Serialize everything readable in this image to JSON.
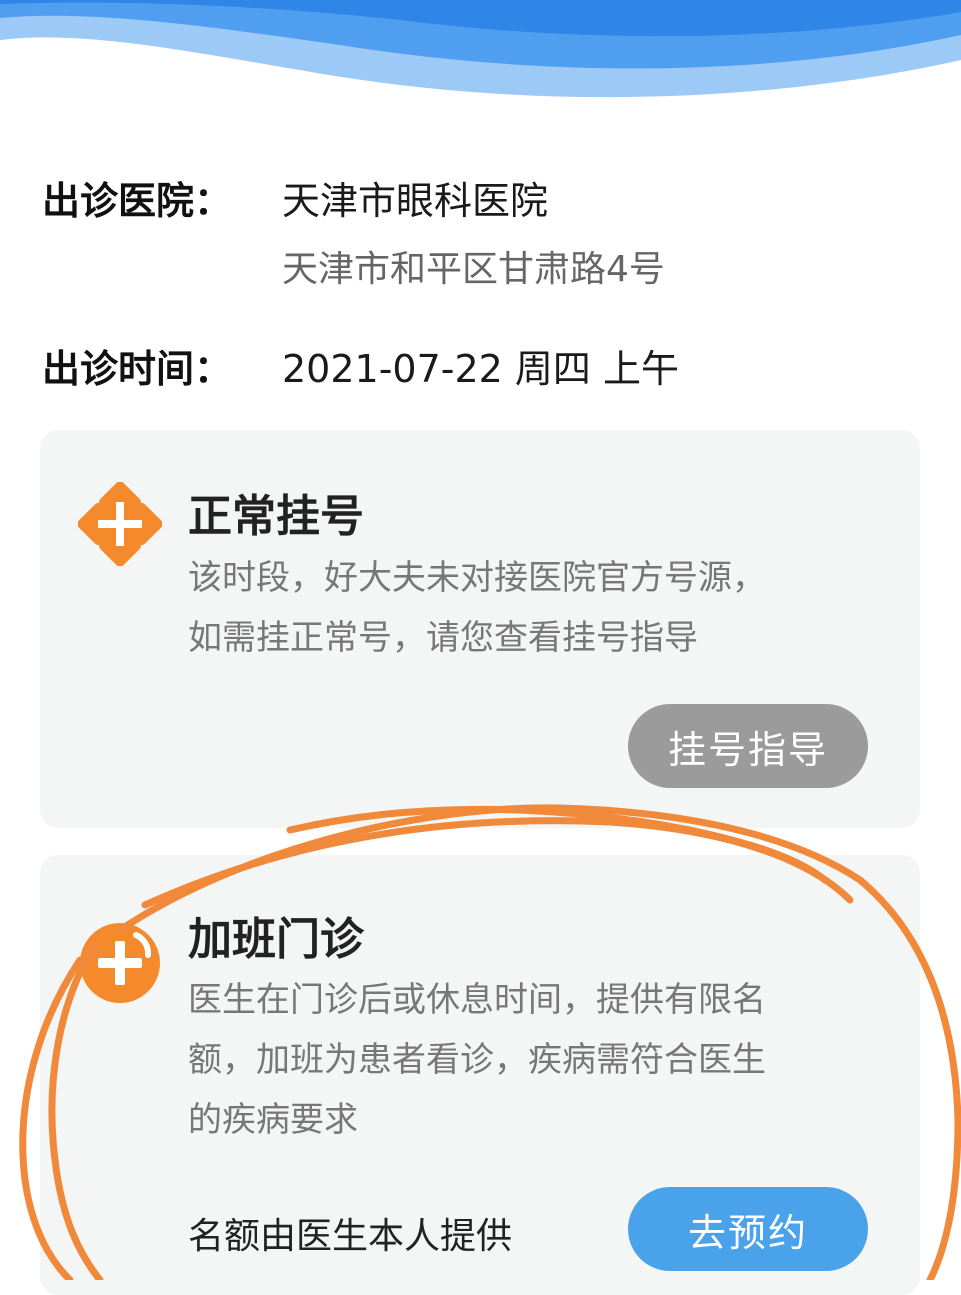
{
  "info": {
    "hospital_label": "出诊医院：",
    "hospital_name": "天津市眼科医院",
    "hospital_address": "天津市和平区甘肃路4号",
    "time_label": "出诊时间：",
    "time_value": "2021-07-22 周四 上午"
  },
  "normal": {
    "title": "正常挂号",
    "desc": [
      "该时段，好大夫未对接医院官方号源，",
      "如需挂正常号，请您查看挂号指导"
    ],
    "button": "挂号指导"
  },
  "overtime": {
    "title": "加班门诊",
    "desc": [
      "医生在门诊后或休息时间，提供有限名",
      "额，加班为患者看诊，疾病需符合医生",
      "的疾病要求"
    ],
    "quota": "名额由医生本人提供",
    "button": "去预约"
  },
  "colors": {
    "accent_orange": "#f58a2c",
    "button_blue": "#4aa3ea",
    "button_gray": "#9b9b9b",
    "annotation": "#f0893a"
  }
}
